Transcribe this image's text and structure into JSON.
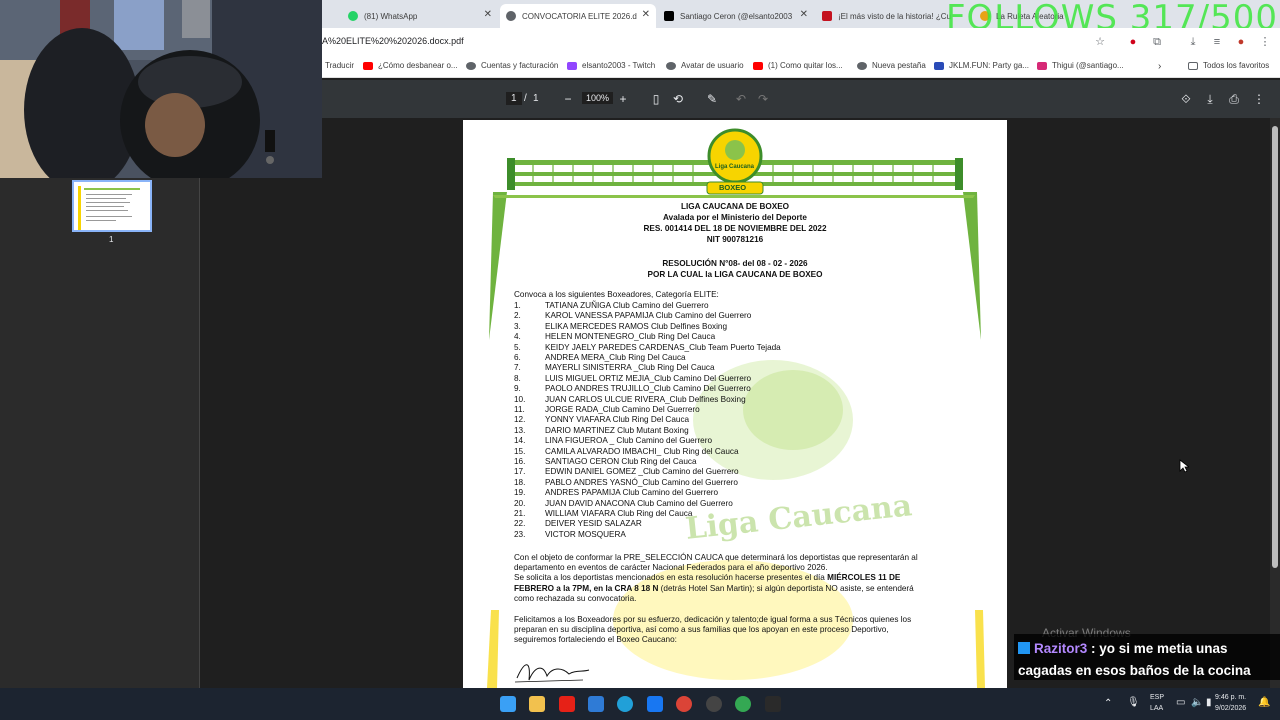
{
  "tabs": [
    {
      "title": "(81) WhatsApp",
      "color": "#25d366"
    },
    {
      "title": "CONVOCATORIA ELITE  2026.d",
      "color": "#5f6368",
      "active": true
    },
    {
      "title": "Santiago Ceron (@elsanto2003",
      "color": "#000000"
    },
    {
      "title": "¡El más visto de la historia! ¿Cu",
      "color": "#c4121f"
    },
    {
      "title": "La Ruleta Aleatoria",
      "color": "#e8a317"
    }
  ],
  "overlay_follows": "FOLLOWS 317/500",
  "url": "A%20ELITE%20%202026.docx.pdf",
  "bookmarks": [
    {
      "label": "Traducir",
      "color": "#4285f4"
    },
    {
      "label": "¿Cómo desbanear o...",
      "color": "#ff0000"
    },
    {
      "label": "Cuentas y facturación",
      "color": "#5f6368"
    },
    {
      "label": "elsanto2003 - Twitch",
      "color": "#9146ff"
    },
    {
      "label": "Avatar de usuario",
      "color": "#5f6368"
    },
    {
      "label": "(1) Como quitar los...",
      "color": "#ff0000"
    },
    {
      "label": "Nueva pestaña",
      "color": "#5f6368"
    },
    {
      "label": "JKLM.FUN: Party ga...",
      "color": "#2a4bb8"
    },
    {
      "label": "Thigui (@santiago...",
      "color": "#d62976"
    }
  ],
  "bookmarks_more": "Todos los favoritos",
  "pdf_toolbar": {
    "page_current": "1",
    "page_sep": "/",
    "page_total": "1",
    "zoom": "100%"
  },
  "thumbnail_label": "1",
  "doc": {
    "h1": "LIGA CAUCANA DE BOXEO",
    "h2": "Avalada por el Ministerio del Deporte",
    "h3": "RES. 001414 DEL 18 DE NOVIEMBRE DEL 2022",
    "h4": "NIT 900781216",
    "res1": "RESOLUCIÓN N°08- del 08 - 02 - 2026",
    "res2": "POR LA CUAL la  LIGA CAUCANA DE BOXEO",
    "intro": "Convoca a los siguientes Boxeadores, Categoría ELITE:",
    "logo_top": "Liga Caucana",
    "logo_bottom": "BOXEO",
    "watermark": "Liga Caucana",
    "list": [
      [
        "1.",
        "TATIANA ZUÑIGA Club Camino del Guerrero"
      ],
      [
        "2.",
        "KAROL VANESSA PAPAMIJA Club Camino del Guerrero"
      ],
      [
        "3.",
        "ELIKA MERCEDES RAMOS Club Delfines Boxing"
      ],
      [
        "4.",
        "HELEN MONTENEGRO_Club Ring Del Cauca"
      ],
      [
        "5.",
        "KEIDY JAELY PAREDES CARDENAS_Club Team Puerto Tejada"
      ],
      [
        "6.",
        "ANDREA MERA_Club Ring Del Cauca"
      ],
      [
        "7.",
        "MAYERLI SINISTERRA _Club Ring Del Cauca"
      ],
      [
        "8.",
        "LUIS MIGUEL ORTIZ MEJIA_Club Camino Del Guerrero"
      ],
      [
        "9.",
        "PAOLO ANDRES TRUJILLO_Club Camino Del Guerrero"
      ],
      [
        "10.",
        "JUAN CARLOS ULCUE RIVERA_Club Delfines Boxing"
      ],
      [
        "11.",
        "JORGE RADA_Club Camino Del Guerrero"
      ],
      [
        "12.",
        "YONNY VIAFARA Club Ring Del Cauca"
      ],
      [
        "13.",
        "DARIO MARTINEZ Club Mutant Boxing"
      ],
      [
        "14.",
        "LINA FIGUEROA _ Club Camino del Guerrero"
      ],
      [
        "15.",
        "CAMILA ALVARADO IMBACHI_ Club Ring del Cauca"
      ],
      [
        "16.",
        "SANTIAGO CERON Club Ring del Cauca"
      ],
      [
        "17.",
        "EDWIN DANIEL GOMEZ _Club Camino del Guerrero"
      ],
      [
        "18.",
        "PABLO ANDRES YASNÓ_Club Camino del Guerrero"
      ],
      [
        "19.",
        "ANDRES PAPAMIJA Club Camino del Guerrero"
      ],
      [
        "20.",
        "JUAN DAVID ANACONA Club Camino del Guerrero"
      ],
      [
        "21.",
        "WILLIAM VIAFARA Club Ring del Cauca"
      ],
      [
        "22.",
        "DEIVER YESID SALAZAR"
      ],
      [
        "23.",
        "VICTOR MOSQUERA"
      ]
    ],
    "p1a": "Con el objeto de conformar la PRE_SELECCIÓN CAUCA que determinará los deportistas que representarán al",
    "p1b": "departamento en eventos de carácter Nacional Federados para el año deportivo 2026.",
    "p1c": "Se solicita a los deportistas mencionados en esta resolución hacerse presentes el día ",
    "p1c_bold": "MIÉRCOLES  11 DE",
    "p1d_bold": "FEBRERO a la 7PM, en la CRA 8 18 N ",
    "p1d": "(detrás Hotel San Martin); si algún deportista NO asiste, se entenderá",
    "p1e": "como rechazada su convocatoria.",
    "p2a": "Felicitamos a los Boxeadores por su esfuerzo, dedicación y talento;de igual forma a sus Técnicos quienes los",
    "p2b": "preparan en su disciplina deportiva, así como a sus familias que los apoyan en este proceso Deportivo,",
    "p2c": "seguiremos fortaleciendo el Boxeo Caucano:"
  },
  "watermark_windows": "Activar Windows",
  "chat": {
    "user": "Razitor3",
    "sep": " : ",
    "message": "yo si me metia unas cagadas en esos baños de la cocina",
    "user_color": "#b388ff"
  },
  "tray": {
    "lang1": "ESP",
    "lang2": "LAA",
    "time": "9:46 p. m.",
    "date": "9/02/2026"
  },
  "taskbar_apps": [
    {
      "name": "start",
      "color": "#3aa0f5"
    },
    {
      "name": "files",
      "color": "#f2c14e"
    },
    {
      "name": "youtube",
      "color": "#e62117"
    },
    {
      "name": "store",
      "color": "#2f7bd6"
    },
    {
      "name": "edge",
      "color": "#21a0d8"
    },
    {
      "name": "facebook",
      "color": "#1877f2"
    },
    {
      "name": "chrome",
      "color": "#db4437"
    },
    {
      "name": "chrome-dev",
      "color": "#444444"
    },
    {
      "name": "chrome-profile",
      "color": "#34a853"
    },
    {
      "name": "epic",
      "color": "#2a2a2a"
    }
  ]
}
